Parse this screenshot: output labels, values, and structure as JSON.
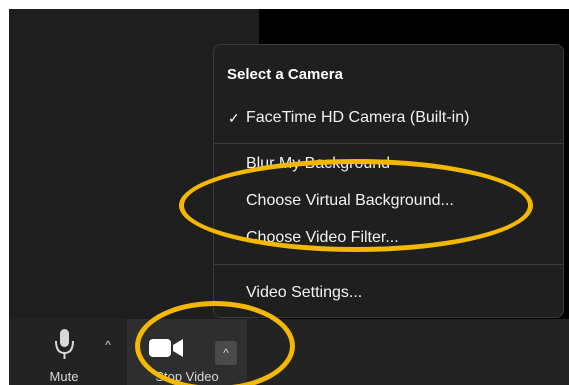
{
  "menu": {
    "header": "Select a Camera",
    "check_mark": "✓",
    "camera_item": "FaceTime HD Camera (Built-in)",
    "blur_item": "Blur My Background",
    "virtual_background_item": "Choose Virtual Background...",
    "video_filter_item": "Choose Video Filter...",
    "video_settings_item": "Video Settings..."
  },
  "toolbar": {
    "mute_label": "Mute",
    "stop_video_label": "Stop Video",
    "caret": "^"
  },
  "colors": {
    "highlight": "#f5b800",
    "menu_bg": "#1f1f1f",
    "toolbar_bg": "#232323"
  },
  "icons": {
    "microphone": "microphone-icon",
    "video_camera": "video-camera-icon",
    "check": "check-icon",
    "caret": "caret-up-icon"
  }
}
